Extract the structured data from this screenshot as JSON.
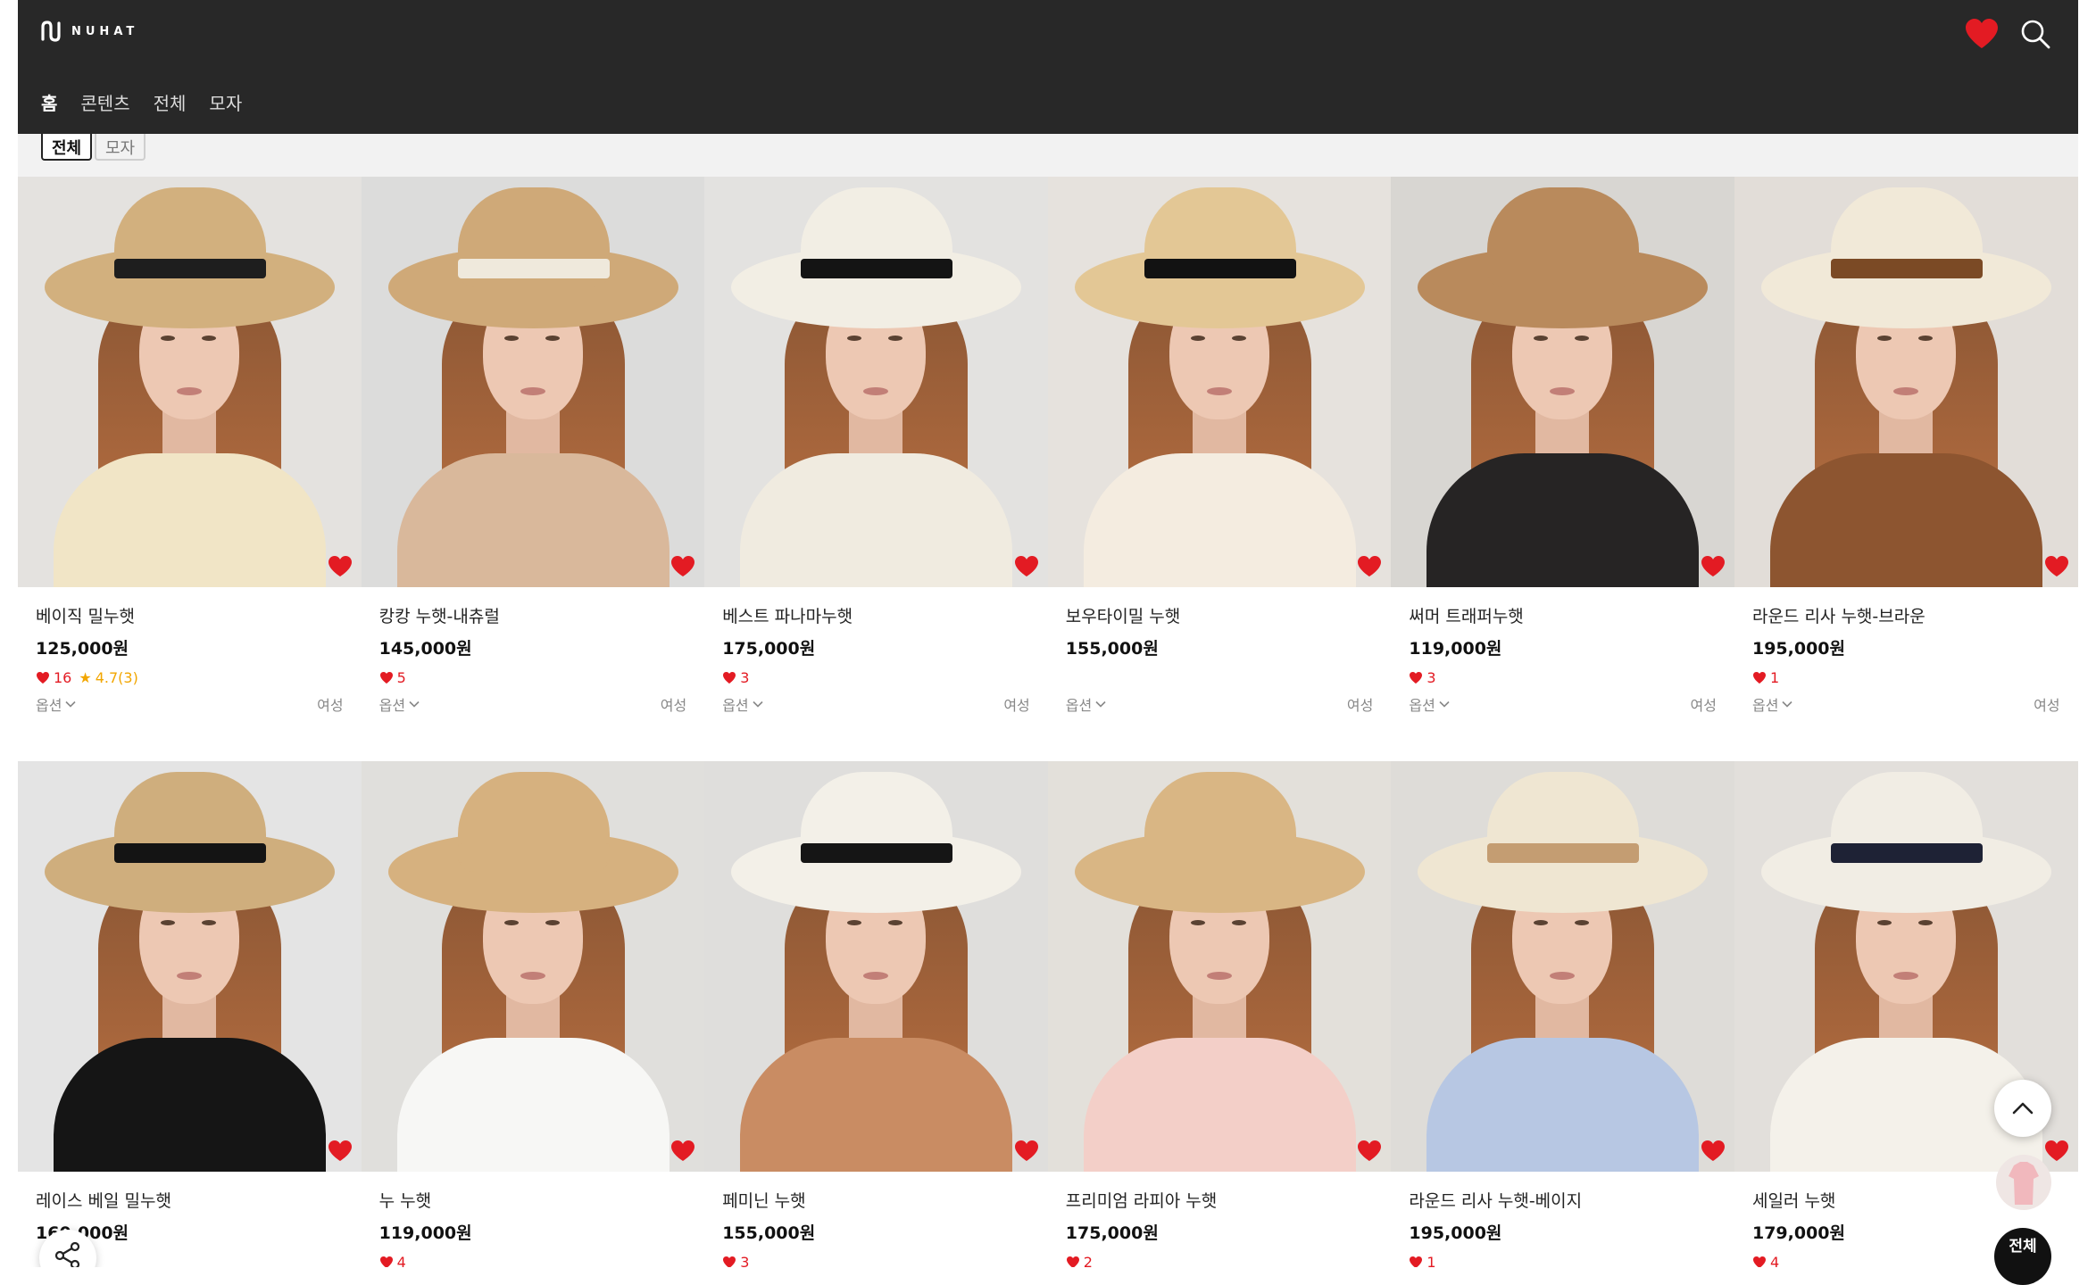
{
  "brand": {
    "name": "NUHAT",
    "logo_icon": "nuhat-logo-icon"
  },
  "header": {
    "wishlist_icon": "heart-icon",
    "search_icon": "search-icon",
    "accent": "#e31b23",
    "bg": "#282828"
  },
  "nav": {
    "items": [
      {
        "label": "홈"
      },
      {
        "label": "콘텐츠"
      },
      {
        "label": "전체"
      },
      {
        "label": "모자"
      }
    ],
    "active": 0
  },
  "filters": {
    "chips": [
      {
        "label": "전체"
      },
      {
        "label": "모자"
      }
    ],
    "active": 0
  },
  "product_labels": {
    "options": "옵션",
    "gender": "여성"
  },
  "products": [
    {
      "name": "베이직 밀누햇",
      "price": "125,000원",
      "likes": "16",
      "rating": "4.7(3)",
      "colors": {
        "wall": "#e4e2df",
        "hat": "#d2b07e",
        "band": "#1e1e1e",
        "body": "#f1e5c6"
      }
    },
    {
      "name": "캉캉 누햇-내츄럴",
      "price": "145,000원",
      "likes": "5",
      "rating": "",
      "colors": {
        "wall": "#dcdcdb",
        "hat": "#cfa978",
        "band": "#efe9dc",
        "body": "#d9b89b"
      }
    },
    {
      "name": "베스트 파나마누햇",
      "price": "175,000원",
      "likes": "3",
      "rating": "",
      "colors": {
        "wall": "#e3e2e0",
        "hat": "#f2eee4",
        "band": "#141414",
        "body": "#f0ebe0"
      }
    },
    {
      "name": "보우타이밀 누햇",
      "price": "155,000원",
      "likes": "",
      "rating": "",
      "colors": {
        "wall": "#e6e2dd",
        "hat": "#e3c795",
        "band": "#121212",
        "body": "#f4ece0"
      }
    },
    {
      "name": "써머 트래퍼누햇",
      "price": "119,000원",
      "likes": "3",
      "rating": "",
      "colors": {
        "wall": "#d8d6d2",
        "hat": "#b98a5c",
        "band": "#b98a5c",
        "body": "#262424"
      }
    },
    {
      "name": "라운드 리사 누햇-브라운",
      "price": "195,000원",
      "likes": "1",
      "rating": "",
      "colors": {
        "wall": "#e2ddd8",
        "hat": "#f1e9d8",
        "band": "#7b4a25",
        "body": "#8d5530"
      }
    },
    {
      "name": "레이스 베일 밀누햇",
      "price": "160,000원",
      "likes": "",
      "rating": "",
      "colors": {
        "wall": "#e4e4e4",
        "hat": "#cfae7d",
        "band": "#141414",
        "body": "#151515"
      }
    },
    {
      "name": "누 누햇",
      "price": "119,000원",
      "likes": "4",
      "rating": "",
      "colors": {
        "wall": "#e0dfdc",
        "hat": "#d6b17f",
        "band": "#d6b17f",
        "body": "#f7f7f5"
      }
    },
    {
      "name": "페미닌 누햇",
      "price": "155,000원",
      "likes": "3",
      "rating": "",
      "colors": {
        "wall": "#dfdedc",
        "hat": "#f3f0e8",
        "band": "#151515",
        "body": "#c98c63"
      }
    },
    {
      "name": "프리미엄 라피아 누햇",
      "price": "175,000원",
      "likes": "2",
      "rating": "",
      "colors": {
        "wall": "#e3e0da",
        "hat": "#d9b684",
        "band": "#d9b684",
        "body": "#f3cfc8"
      }
    },
    {
      "name": "라운드 리사 누햇-베이지",
      "price": "195,000원",
      "likes": "1",
      "rating": "",
      "colors": {
        "wall": "#dedcd8",
        "hat": "#efe6d2",
        "band": "#c49d72",
        "body": "#b7c7e3"
      }
    },
    {
      "name": "세일러 누햇",
      "price": "179,000원",
      "likes": "4",
      "rating": "",
      "colors": {
        "wall": "#e2dfdb",
        "hat": "#f1ede4",
        "band": "#1e2235",
        "body": "#f4f1ea"
      }
    }
  ],
  "floating": {
    "top_icon": "chevron-up-icon",
    "all_label": "전체",
    "share_icon": "share-icon"
  }
}
